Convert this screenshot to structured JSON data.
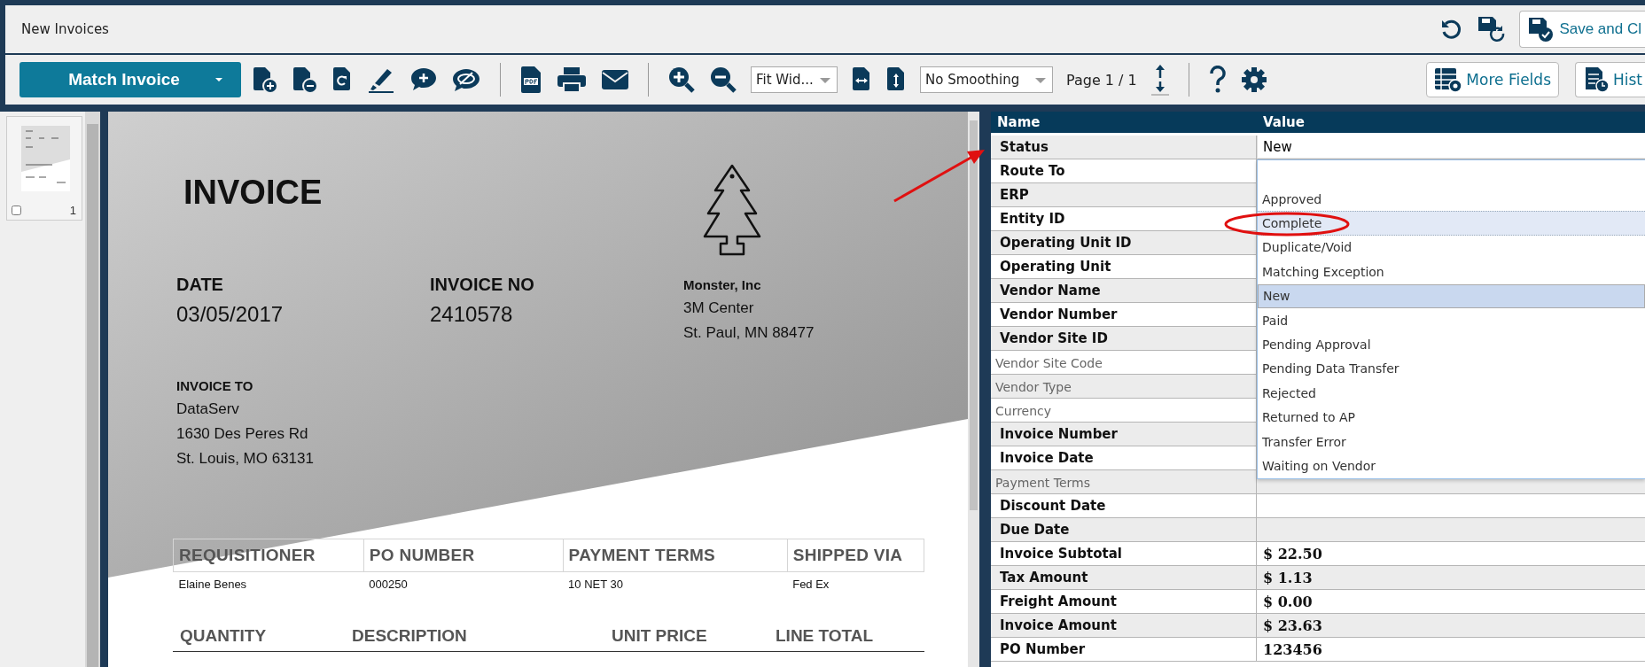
{
  "window": {
    "title": "New Invoices"
  },
  "header": {
    "save_button": "Save and Cl"
  },
  "toolbar": {
    "primary_button": "Match Invoice",
    "zoom_select": "Fit Wid...",
    "smoothing_select": "No Smoothing",
    "page_label": "Page 1 /",
    "page_total": "1",
    "more_fields_button": "More Fields",
    "history_button": "Hist"
  },
  "thumbnails": [
    {
      "page": "1",
      "checked": false
    }
  ],
  "document": {
    "title": "INVOICE",
    "date_label": "DATE",
    "date": "03/05/2017",
    "number_label": "INVOICE NO",
    "number": "2410578",
    "company": [
      "Monster, Inc",
      "3M Center",
      "St. Paul, MN 88477"
    ],
    "bill_to_label": "INVOICE TO",
    "bill_to": [
      "DataServ",
      "1630 Des Peres Rd",
      "St. Louis, MO 63131"
    ],
    "order_table": {
      "columns": [
        "REQUISITIONER",
        "PO NUMBER",
        "PAYMENT TERMS",
        "SHIPPED VIA"
      ],
      "row": [
        "Elaine Benes",
        "000250",
        "10 NET 30",
        "Fed Ex"
      ]
    },
    "line_columns": [
      "QUANTITY",
      "DESCRIPTION",
      "UNIT PRICE",
      "LINE TOTAL"
    ]
  },
  "fields": {
    "columns": [
      "Name",
      "Value"
    ],
    "rows": [
      {
        "name": "Status",
        "required": true,
        "kind": "input",
        "value": "New"
      },
      {
        "name": "Route To",
        "required": true,
        "kind": "text"
      },
      {
        "name": "ERP",
        "required": true,
        "kind": "text"
      },
      {
        "name": "Entity ID",
        "required": true,
        "kind": "text"
      },
      {
        "name": "Operating Unit ID",
        "required": true,
        "kind": "text"
      },
      {
        "name": "Operating Unit",
        "required": true,
        "kind": "text"
      },
      {
        "name": "Vendor Name",
        "required": true,
        "kind": "text"
      },
      {
        "name": "Vendor Number",
        "required": true,
        "kind": "text"
      },
      {
        "name": "Vendor Site ID",
        "required": true,
        "kind": "text"
      },
      {
        "name": "Vendor Site Code",
        "required": false,
        "kind": "text"
      },
      {
        "name": "Vendor Type",
        "required": false,
        "kind": "text"
      },
      {
        "name": "Currency",
        "required": false,
        "kind": "text"
      },
      {
        "name": "Invoice Number",
        "required": true,
        "kind": "text"
      },
      {
        "name": "Invoice Date",
        "required": true,
        "kind": "text"
      },
      {
        "name": "Payment Terms",
        "required": false,
        "kind": "text"
      },
      {
        "name": "Discount Date",
        "required": true,
        "kind": "text"
      },
      {
        "name": "Due Date",
        "required": true,
        "kind": "text"
      },
      {
        "name": "Invoice Subtotal",
        "required": true,
        "kind": "text",
        "value": "$ 22.50"
      },
      {
        "name": "Tax Amount",
        "required": true,
        "kind": "text",
        "value": "$ 1.13"
      },
      {
        "name": "Freight Amount",
        "required": true,
        "kind": "text",
        "value": "$ 0.00"
      },
      {
        "name": "Invoice Amount",
        "required": true,
        "kind": "text",
        "value": "$ 23.63"
      },
      {
        "name": "PO Number",
        "required": true,
        "kind": "text",
        "value": "123456"
      }
    ]
  },
  "dropdown": {
    "options": [
      {
        "label": "Approved",
        "selected": false,
        "hovered": false
      },
      {
        "label": "Complete",
        "selected": false,
        "hovered": true
      },
      {
        "label": "Duplicate/Void",
        "selected": false,
        "hovered": false
      },
      {
        "label": "Matching Exception",
        "selected": false,
        "hovered": false
      },
      {
        "label": "New",
        "selected": true,
        "hovered": false
      },
      {
        "label": "Paid",
        "selected": false,
        "hovered": false
      },
      {
        "label": "Pending Approval",
        "selected": false,
        "hovered": false
      },
      {
        "label": "Pending Data Transfer",
        "selected": false,
        "hovered": false
      },
      {
        "label": "Rejected",
        "selected": false,
        "hovered": false
      },
      {
        "label": "Returned to AP",
        "selected": false,
        "hovered": false
      },
      {
        "label": "Transfer Error",
        "selected": false,
        "hovered": false
      },
      {
        "label": "Waiting on Vendor",
        "selected": false,
        "hovered": false
      }
    ]
  }
}
